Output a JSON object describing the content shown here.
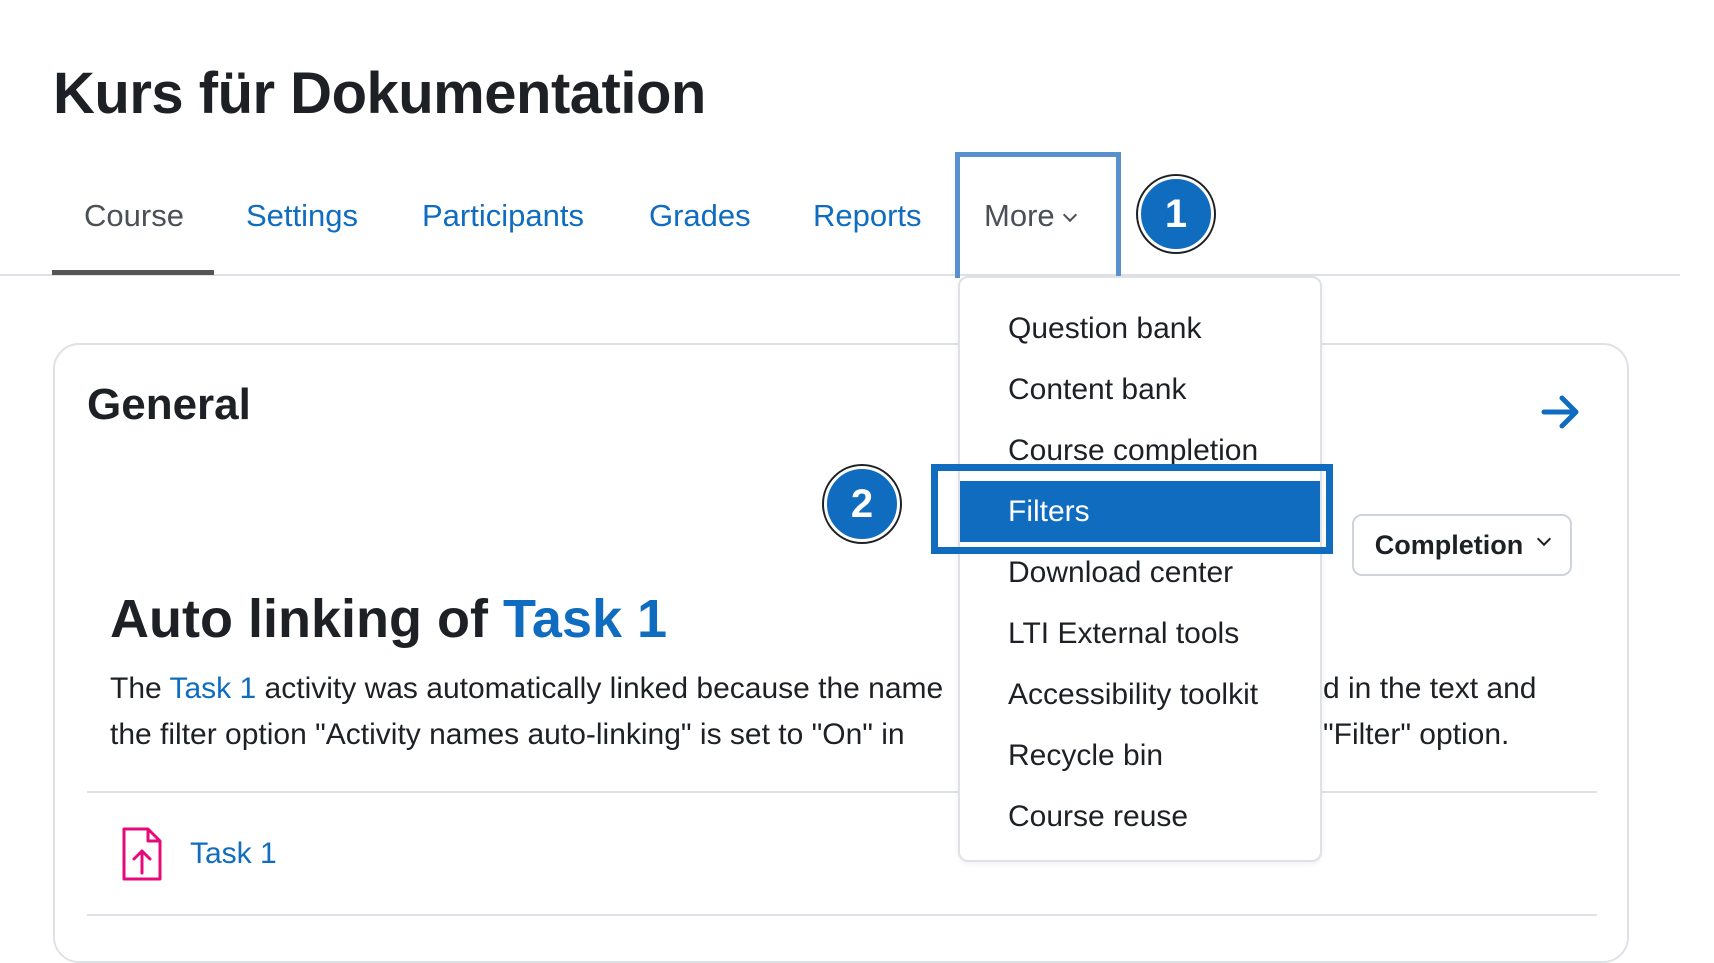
{
  "page": {
    "title": "Kurs für Dokumentation"
  },
  "nav": {
    "tabs": [
      {
        "label": "Course",
        "active": true
      },
      {
        "label": "Settings",
        "active": false
      },
      {
        "label": "Participants",
        "active": false
      },
      {
        "label": "Grades",
        "active": false
      },
      {
        "label": "Reports",
        "active": false
      },
      {
        "label": "More",
        "active": false,
        "icon": "chevron-down-icon"
      }
    ]
  },
  "badges": {
    "step1": "1",
    "step2": "2"
  },
  "dropdown": {
    "items": [
      {
        "label": "Question bank",
        "highlighted": false
      },
      {
        "label": "Content bank",
        "highlighted": false
      },
      {
        "label": "Course completion",
        "highlighted": false
      },
      {
        "label": "Filters",
        "highlighted": true
      },
      {
        "label": "Download center",
        "highlighted": false
      },
      {
        "label": "LTI External tools",
        "highlighted": false
      },
      {
        "label": "Accessibility toolkit",
        "highlighted": false
      },
      {
        "label": "Recycle bin",
        "highlighted": false
      },
      {
        "label": "Course reuse",
        "highlighted": false
      }
    ]
  },
  "section": {
    "title": "General",
    "arrow_icon": "arrow-right-icon",
    "completion_button": "Completion"
  },
  "label": {
    "heading_prefix": "Auto linking of ",
    "heading_link": "Task 1",
    "text_prefix": "The ",
    "text_link": "Task 1",
    "text_line1_rest": " activity was automatically linked because the name",
    "text_line1_end": "d in the text and",
    "text_line2_start": "the filter option \"Activity names auto-linking\" is set to \"On\" in",
    "text_line2_end": "\"Filter\" option."
  },
  "activity": {
    "icon": "assignment-upload-icon",
    "name": "Task 1"
  },
  "colors": {
    "link": "#0f6cbf",
    "text": "#1d2125",
    "tab_active": "#495057",
    "border": "#dee2e6",
    "highlight_box": "#5b90cf",
    "activity_icon": "#e6097c",
    "badge_fill": "#0f6cbf"
  }
}
